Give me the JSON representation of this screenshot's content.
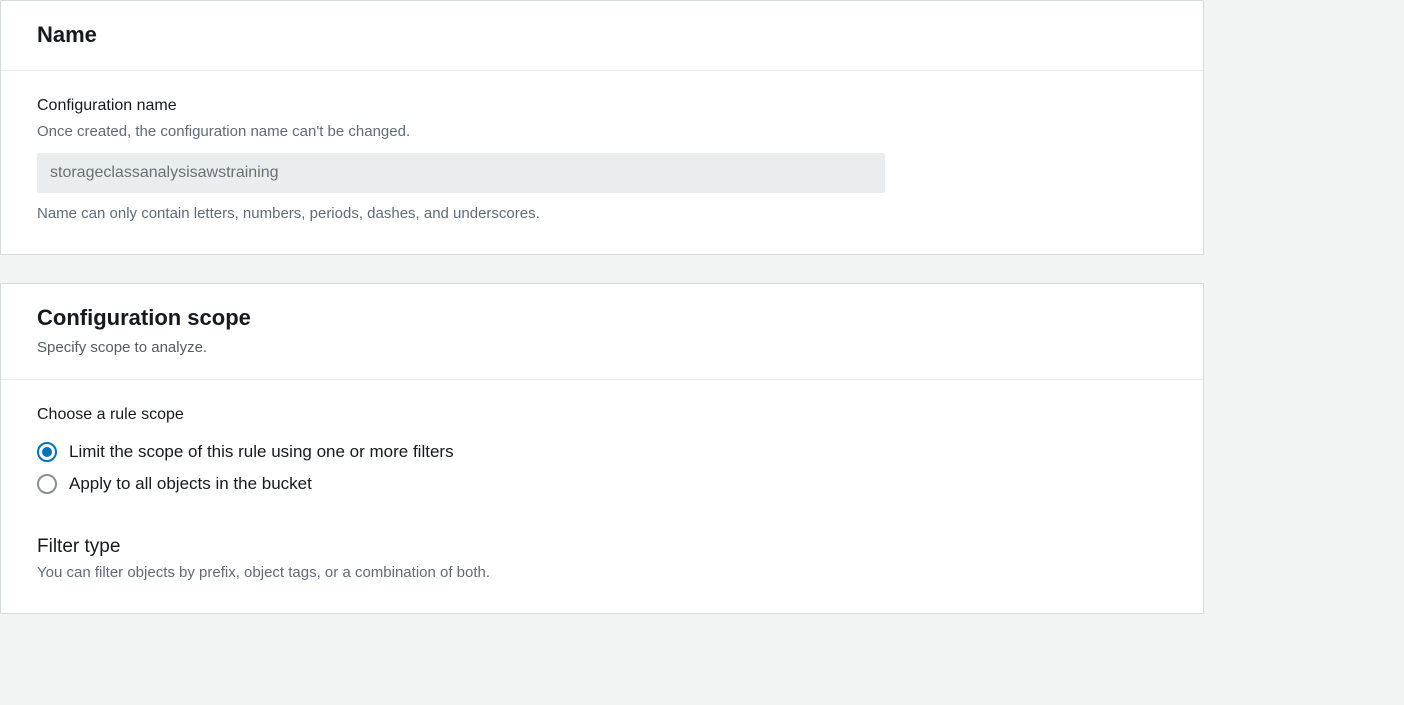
{
  "namePanel": {
    "title": "Name",
    "field": {
      "label": "Configuration name",
      "hint": "Once created, the configuration name can't be changed.",
      "value": "storageclassanalysisawstraining",
      "help": "Name can only contain letters, numbers, periods, dashes, and underscores."
    }
  },
  "scopePanel": {
    "title": "Configuration scope",
    "subtitle": "Specify scope to analyze.",
    "ruleScope": {
      "label": "Choose a rule scope",
      "options": {
        "limit": "Limit the scope of this rule using one or more filters",
        "all": "Apply to all objects in the bucket"
      },
      "selected": "limit"
    },
    "filterType": {
      "title": "Filter type",
      "hint": "You can filter objects by prefix, object tags, or a combination of both."
    }
  }
}
